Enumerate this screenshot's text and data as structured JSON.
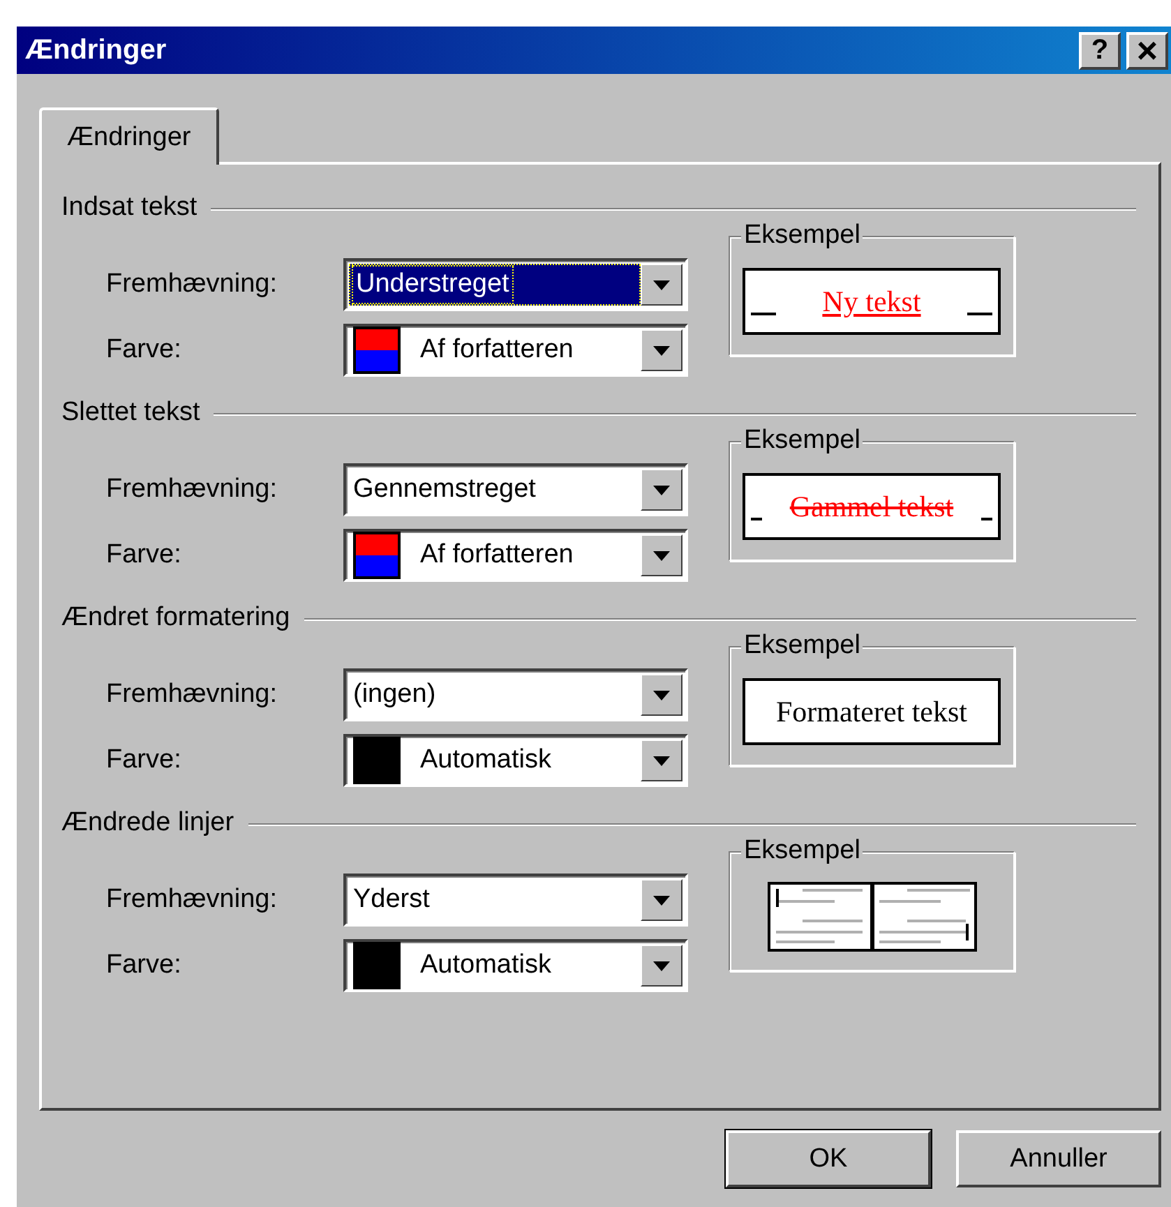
{
  "window": {
    "title": "Ændringer"
  },
  "title_buttons": [
    {
      "kind": "help",
      "label": "?"
    },
    {
      "kind": "close",
      "label": "×"
    }
  ],
  "tabs": [
    {
      "label": "Ændringer",
      "selected": true
    }
  ],
  "sections": [
    {
      "heading": "Indsat tekst",
      "mark": {
        "label": "Fremhævning:",
        "value": "Understreget",
        "selected": true
      },
      "color": {
        "label": "Farve:",
        "value": "Af forfatteren",
        "kind": "by-author",
        "selected": false
      },
      "example": {
        "legend": "Eksempel",
        "kind": "underline",
        "text": "Ny tekst"
      }
    },
    {
      "heading": "Slettet tekst",
      "mark": {
        "label": "Fremhævning:",
        "value": "Gennemstreget",
        "selected": false
      },
      "color": {
        "label": "Farve:",
        "value": "Af forfatteren",
        "kind": "by-author",
        "selected": false
      },
      "example": {
        "legend": "Eksempel",
        "kind": "strikethrough",
        "text": "Gammel tekst"
      }
    },
    {
      "heading": "Ændret formatering",
      "mark": {
        "label": "Fremhævning:",
        "value": "(ingen)",
        "selected": false
      },
      "color": {
        "label": "Farve:",
        "value": "Automatisk",
        "kind": "automatic",
        "selected": false
      },
      "example": {
        "legend": "Eksempel",
        "kind": "plain",
        "text": "Formateret tekst"
      }
    },
    {
      "heading": "Ændrede linjer",
      "mark": {
        "label": "Fremhævning:",
        "value": "Yderst",
        "selected": false
      },
      "color": {
        "label": "Farve:",
        "value": "Automatisk",
        "kind": "automatic",
        "selected": false
      },
      "example": {
        "legend": "Eksempel",
        "kind": "lines"
      }
    }
  ],
  "buttons": [
    {
      "label": "OK",
      "default": true
    },
    {
      "label": "Annuller",
      "default": false
    }
  ]
}
